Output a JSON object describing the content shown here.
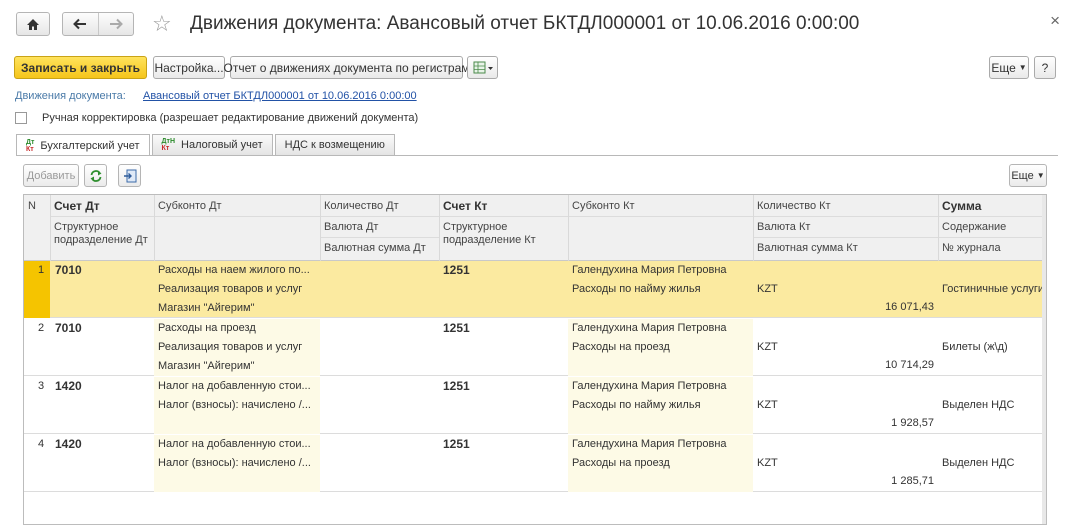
{
  "window": {
    "title": "Движения документа: Авансовый отчет БКТДЛ000001 от 10.06.2016 0:00:00",
    "close": "×"
  },
  "toolbar": {
    "save_close": "Записать и закрыть",
    "settings": "Настройка...",
    "report": "Отчет о движениях документа по регистрам",
    "more": "Еще",
    "help": "?"
  },
  "doc_link": {
    "label": "Движения документа:",
    "value": "Авансовый отчет БКТДЛ000001 от 10.06.2016 0:00:00"
  },
  "manual": {
    "label": "Ручная корректировка (разрешает редактирование движений документа)",
    "checked": false
  },
  "tabs": [
    {
      "label": "Бухгалтерский учет",
      "icon": "accounting-icon",
      "active": true
    },
    {
      "label": "Налоговый учет",
      "icon": "tax-icon",
      "active": false
    },
    {
      "label": "НДС к возмещению",
      "icon": "",
      "active": false
    }
  ],
  "table_toolbar": {
    "add": "Добавить",
    "more": "Еще"
  },
  "columns": {
    "n": "N",
    "dt_account": "Счет Дт",
    "dt_dept": "Структурное подразделение Дт",
    "dt_subconto": "Субконто Дт",
    "dt_qty": "Количество Дт",
    "dt_currency": "Валюта Дт",
    "dt_cur_sum": "Валютная сумма Дт",
    "kt_account": "Счет Кт",
    "kt_dept": "Структурное подразделение Кт",
    "kt_subconto": "Субконто Кт",
    "kt_qty": "Количество Кт",
    "kt_currency": "Валюта Кт",
    "kt_cur_sum": "Валютная сумма Кт",
    "sum": "Сумма",
    "content": "Содержание",
    "journal": "№ журнала"
  },
  "rows": [
    {
      "n": "1",
      "dt": "7010",
      "dt_sub": [
        "Расходы на наем жилого по...",
        "Реализация товаров и услуг",
        "Магазин \"Айгерим\""
      ],
      "kt": "1251",
      "kt_sub": [
        "Галендухина Мария Петровна",
        "Расходы по найму жилья"
      ],
      "kt_currency": "KZT",
      "amount": "16 071,43",
      "content": "Гостиничные услуги"
    },
    {
      "n": "2",
      "dt": "7010",
      "dt_sub": [
        "Расходы на проезд",
        "Реализация товаров и услуг",
        "Магазин \"Айгерим\""
      ],
      "kt": "1251",
      "kt_sub": [
        "Галендухина Мария Петровна",
        "Расходы на проезд"
      ],
      "kt_currency": "KZT",
      "amount": "10 714,29",
      "content": "Билеты (ж\\д)"
    },
    {
      "n": "3",
      "dt": "1420",
      "dt_sub": [
        "Налог на добавленную стои...",
        "Налог (взносы): начислено /...",
        ""
      ],
      "kt": "1251",
      "kt_sub": [
        "Галендухина Мария Петровна",
        "Расходы по найму жилья"
      ],
      "kt_currency": "KZT",
      "amount": "1 928,57",
      "content": "Выделен НДС"
    },
    {
      "n": "4",
      "dt": "1420",
      "dt_sub": [
        "Налог на добавленную стои...",
        "Налог (взносы): начислено /...",
        ""
      ],
      "kt": "1251",
      "kt_sub": [
        "Галендухина Мария Петровна",
        "Расходы на проезд"
      ],
      "kt_currency": "KZT",
      "amount": "1 285,71",
      "content": "Выделен НДС"
    }
  ]
}
